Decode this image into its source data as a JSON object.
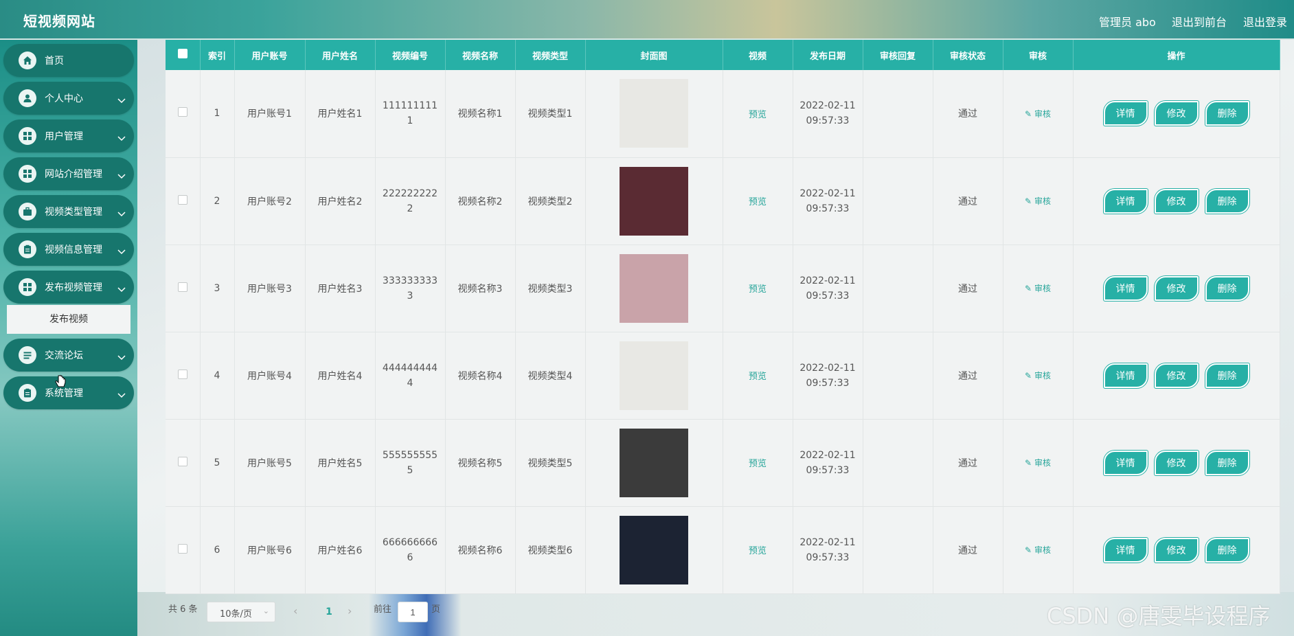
{
  "header": {
    "site_title": "短视频网站",
    "admin_label": "管理员 abo",
    "front_link": "退出到前台",
    "logout_link": "退出登录"
  },
  "sidebar": {
    "items": [
      {
        "label": "首页",
        "icon": "home-icon",
        "has_children": false
      },
      {
        "label": "个人中心",
        "icon": "user-icon",
        "has_children": true
      },
      {
        "label": "用户管理",
        "icon": "grid-icon",
        "has_children": true
      },
      {
        "label": "网站介绍管理",
        "icon": "grid-icon",
        "has_children": true
      },
      {
        "label": "视频类型管理",
        "icon": "briefcase-icon",
        "has_children": true
      },
      {
        "label": "视频信息管理",
        "icon": "clipboard-icon",
        "has_children": true
      },
      {
        "label": "发布视频管理",
        "icon": "grid-icon",
        "has_children": true
      },
      {
        "label": "交流论坛",
        "icon": "list-icon",
        "has_children": true
      },
      {
        "label": "系统管理",
        "icon": "clipboard-icon",
        "has_children": true
      }
    ],
    "submenu": {
      "label": "发布视频"
    }
  },
  "table": {
    "headers": [
      "索引",
      "用户账号",
      "用户姓名",
      "视频编号",
      "视频名称",
      "视频类型",
      "封面图",
      "视频",
      "发布日期",
      "审核回复",
      "审核状态",
      "审核",
      "操作"
    ],
    "rows": [
      {
        "index": "1",
        "account": "用户账号1",
        "name": "用户姓名1",
        "video_no": "1111111111",
        "video_name": "视频名称1",
        "video_type": "视频类型1",
        "video": "预览",
        "date_line1": "2022-02-11",
        "date_line2": "09:57:33",
        "reply": "",
        "status": "通过",
        "audit": "审核",
        "cover_color": "#e8e8e4"
      },
      {
        "index": "2",
        "account": "用户账号2",
        "name": "用户姓名2",
        "video_no": "2222222222",
        "video_name": "视频名称2",
        "video_type": "视频类型2",
        "video": "预览",
        "date_line1": "2022-02-11",
        "date_line2": "09:57:33",
        "reply": "",
        "status": "通过",
        "audit": "审核",
        "cover_color": "#5a2b33"
      },
      {
        "index": "3",
        "account": "用户账号3",
        "name": "用户姓名3",
        "video_no": "3333333333",
        "video_name": "视频名称3",
        "video_type": "视频类型3",
        "video": "预览",
        "date_line1": "2022-02-11",
        "date_line2": "09:57:33",
        "reply": "",
        "status": "通过",
        "audit": "审核",
        "cover_color": "#c9a3a9"
      },
      {
        "index": "4",
        "account": "用户账号4",
        "name": "用户姓名4",
        "video_no": "4444444444",
        "video_name": "视频名称4",
        "video_type": "视频类型4",
        "video": "预览",
        "date_line1": "2022-02-11",
        "date_line2": "09:57:33",
        "reply": "",
        "status": "通过",
        "audit": "审核",
        "cover_color": "#e8e8e4"
      },
      {
        "index": "5",
        "account": "用户账号5",
        "name": "用户姓名5",
        "video_no": "5555555555",
        "video_name": "视频名称5",
        "video_type": "视频类型5",
        "video": "预览",
        "date_line1": "2022-02-11",
        "date_line2": "09:57:33",
        "reply": "",
        "status": "通过",
        "audit": "审核",
        "cover_color": "#3b3b3b"
      },
      {
        "index": "6",
        "account": "用户账号6",
        "name": "用户姓名6",
        "video_no": "6666666666",
        "video_name": "视频名称6",
        "video_type": "视频类型6",
        "video": "预览",
        "date_line1": "2022-02-11",
        "date_line2": "09:57:33",
        "reply": "",
        "status": "通过",
        "audit": "审核",
        "cover_color": "#1c2333"
      }
    ],
    "op_buttons": {
      "detail": "详情",
      "edit": "修改",
      "delete": "删除"
    }
  },
  "pagination": {
    "total": "共 6 条",
    "page_size": "10条/页",
    "current_page": "1",
    "goto_prefix": "前往",
    "goto_value": "1",
    "goto_suffix": "页"
  },
  "watermark": "CSDN @唐雯毕设程序",
  "colors": {
    "accent": "#27b0a6",
    "sidebar_item": "#17766d"
  }
}
